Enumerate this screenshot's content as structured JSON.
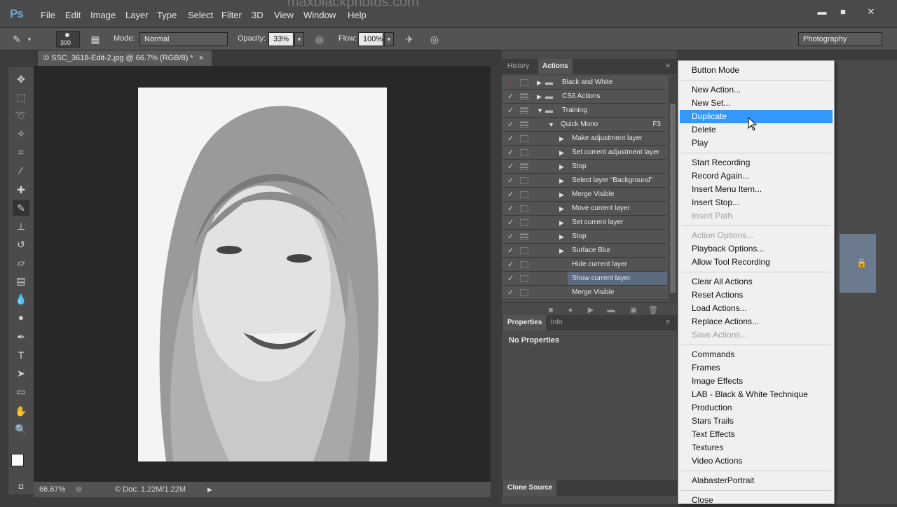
{
  "app": {
    "logo": "Ps",
    "watermark": "maxblackphotos.com"
  },
  "menubar": [
    "File",
    "Edit",
    "Image",
    "Layer",
    "Type",
    "Select",
    "Filter",
    "3D",
    "View",
    "Window",
    "Help"
  ],
  "window_controls": {
    "minimize": "▬",
    "maximize": "■",
    "close": "✕"
  },
  "options": {
    "brush_size": "300",
    "mode_label": "Mode:",
    "mode_value": "Normal",
    "opacity_label": "Opacity:",
    "opacity_value": "33%",
    "flow_label": "Flow:",
    "flow_value": "100%",
    "workspace": "Photography"
  },
  "document": {
    "tab_title": "© SSC_3618-Edit-2.jpg @ 66.7% (RGB/8) *",
    "close": "×"
  },
  "status": {
    "zoom": "66.67%",
    "doc_info": "© Doc: 1.22M/1.22M"
  },
  "panels": {
    "history_tab": "History",
    "actions_tab": "Actions",
    "properties_tab": "Properties",
    "info_tab": "Info",
    "no_properties": "No Properties",
    "clone_source": "Clone Source"
  },
  "actions": [
    {
      "name": "Black and White",
      "level": 0,
      "expanded": false,
      "folder": true,
      "dialog": false,
      "check_red": true
    },
    {
      "name": "CS6 Actions",
      "level": 0,
      "expanded": false,
      "folder": true,
      "dialog": true
    },
    {
      "name": "Training",
      "level": 0,
      "expanded": true,
      "folder": true,
      "dialog": true
    },
    {
      "name": "Quick Mono",
      "level": 1,
      "expanded": true,
      "folder": false,
      "dialog": true,
      "key": "F3"
    },
    {
      "name": "Make adjustment layer",
      "level": 2,
      "expanded": false,
      "dialog": false
    },
    {
      "name": "Set current adjustment layer",
      "level": 2,
      "expanded": false,
      "dialog": false
    },
    {
      "name": "Stop",
      "level": 2,
      "expanded": false,
      "dialog": true
    },
    {
      "name": "Select layer “Background”",
      "level": 2,
      "expanded": false,
      "dialog": false
    },
    {
      "name": "Merge Visible",
      "level": 2,
      "expanded": false,
      "dialog": false
    },
    {
      "name": "Move current layer",
      "level": 2,
      "expanded": false,
      "dialog": false
    },
    {
      "name": "Set current layer",
      "level": 2,
      "expanded": false,
      "dialog": false
    },
    {
      "name": "Stop",
      "level": 2,
      "expanded": false,
      "dialog": true
    },
    {
      "name": "Surface Blur",
      "level": 2,
      "expanded": false,
      "dialog": false
    },
    {
      "name": "Hide current layer",
      "level": 2,
      "leaf": true,
      "dialog": false
    },
    {
      "name": "Show current layer",
      "level": 2,
      "leaf": true,
      "dialog": false,
      "selected": true
    },
    {
      "name": "Merge Visible",
      "level": 2,
      "leaf": true,
      "dialog": false
    }
  ],
  "context_menu": {
    "groups": [
      [
        {
          "label": "Button Mode"
        }
      ],
      [
        {
          "label": "New Action..."
        },
        {
          "label": "New Set..."
        },
        {
          "label": "Duplicate",
          "highlighted": true
        },
        {
          "label": "Delete"
        },
        {
          "label": "Play"
        }
      ],
      [
        {
          "label": "Start Recording"
        },
        {
          "label": "Record Again..."
        },
        {
          "label": "Insert Menu Item..."
        },
        {
          "label": "Insert Stop..."
        },
        {
          "label": "Insert Path",
          "disabled": true
        }
      ],
      [
        {
          "label": "Action Options...",
          "disabled": true
        },
        {
          "label": "Playback Options..."
        },
        {
          "label": "Allow Tool Recording"
        }
      ],
      [
        {
          "label": "Clear All Actions"
        },
        {
          "label": "Reset Actions"
        },
        {
          "label": "Load Actions..."
        },
        {
          "label": "Replace Actions..."
        },
        {
          "label": "Save Actions...",
          "disabled": true
        }
      ],
      [
        {
          "label": "Commands"
        },
        {
          "label": "Frames"
        },
        {
          "label": "Image Effects"
        },
        {
          "label": "LAB - Black & White Technique"
        },
        {
          "label": "Production"
        },
        {
          "label": "Stars Trails"
        },
        {
          "label": "Text Effects"
        },
        {
          "label": "Textures"
        },
        {
          "label": "Video Actions"
        }
      ],
      [
        {
          "label": "AlabasterPortrait"
        }
      ],
      [
        {
          "label": "Close"
        }
      ]
    ]
  }
}
